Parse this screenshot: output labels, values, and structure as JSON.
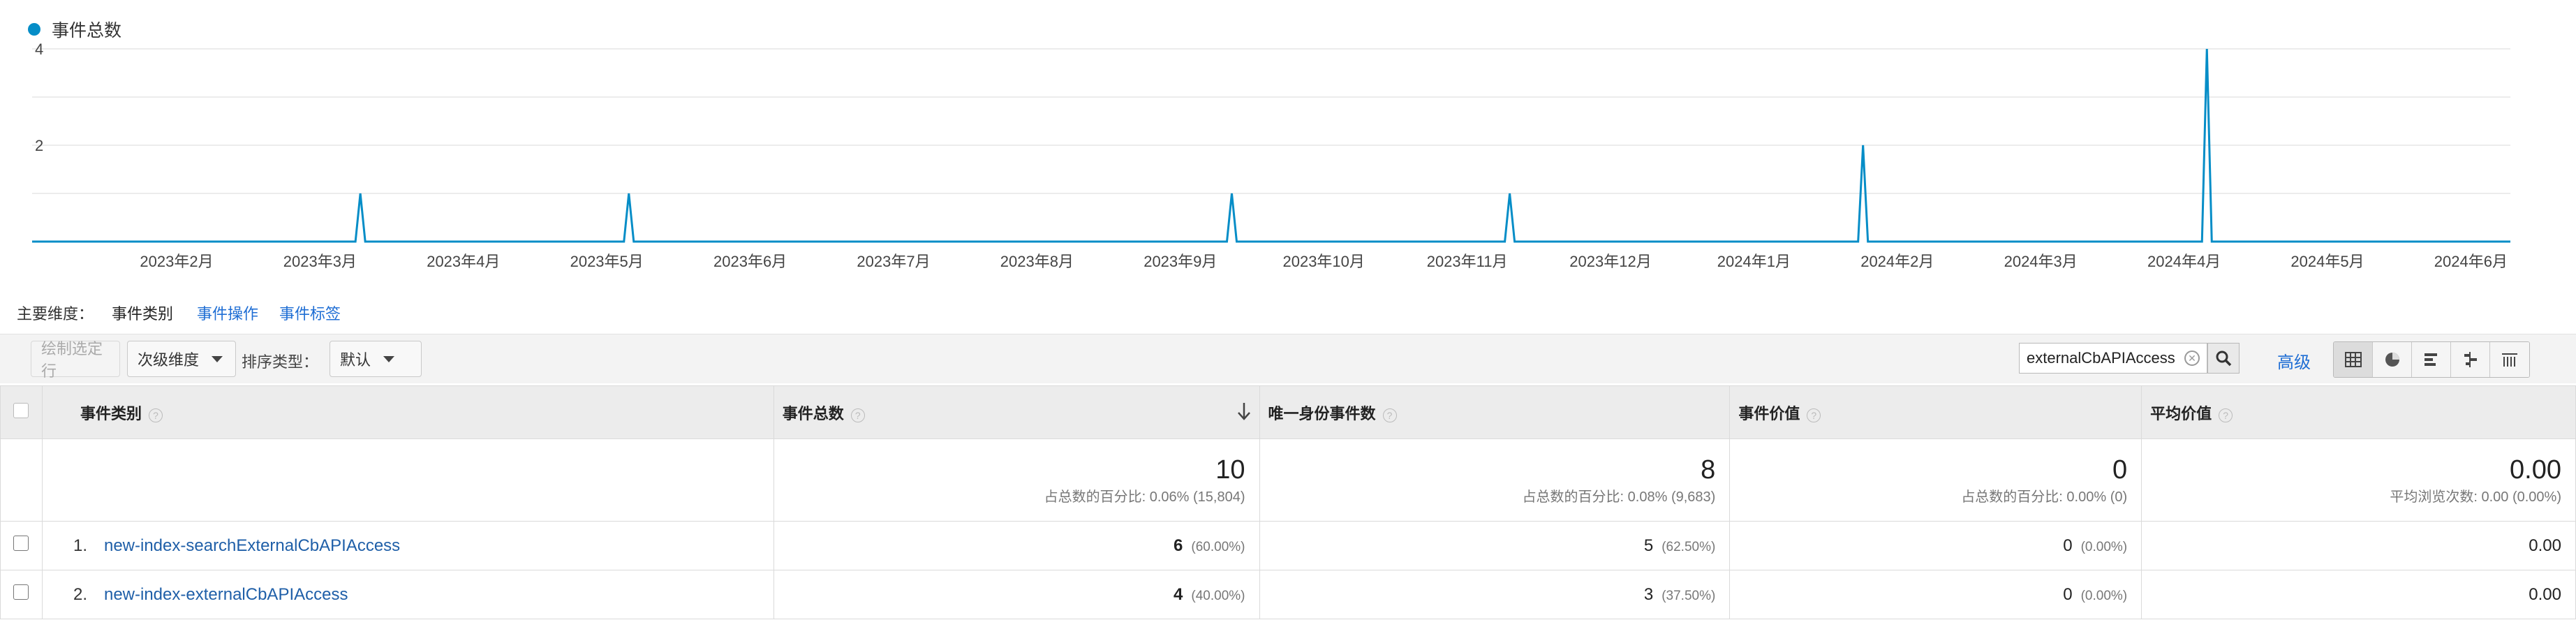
{
  "legend": {
    "label": "事件总数",
    "color": "#058dc7"
  },
  "chart_data": {
    "type": "line",
    "series": [
      {
        "name": "事件总数",
        "color": "#058dc7"
      }
    ],
    "y_ticks": [
      "4",
      "2"
    ],
    "ylim": [
      0,
      4
    ],
    "x_labels": [
      "2023年2月",
      "2023年3月",
      "2023年4月",
      "2023年5月",
      "2023年6月",
      "2023年7月",
      "2023年8月",
      "2023年9月",
      "2023年10月",
      "2023年11月",
      "2023年12月",
      "2024年1月",
      "2024年2月",
      "2024年3月",
      "2024年4月",
      "2024年5月",
      "2024年6月"
    ],
    "spikes": [
      {
        "date": "2023-03-12",
        "value": 1
      },
      {
        "date": "2023-05-08",
        "value": 1
      },
      {
        "date": "2023-09-13",
        "value": 1
      },
      {
        "date": "2023-11-11",
        "value": 1
      },
      {
        "date": "2024-01-25",
        "value": 2
      },
      {
        "date": "2024-04-07",
        "value": 4
      }
    ],
    "baseline": 0,
    "grid": true
  },
  "dimensions": {
    "label": "主要维度：",
    "current": "事件类别",
    "links": [
      "事件操作",
      "事件标签"
    ]
  },
  "toolbar": {
    "plot_rows": "绘制选定行",
    "secondary_dim": "次级维度",
    "sort_label": "排序类型：",
    "sort_value": "默认",
    "search_value": "externalCbAPIAccess",
    "advanced": "高级"
  },
  "table": {
    "headers": [
      "事件类别",
      "事件总数",
      "唯一身份事件数",
      "事件价值",
      "平均价值"
    ],
    "totals": [
      {
        "value": "10",
        "sub": "占总数的百分比: 0.06% (15,804)"
      },
      {
        "value": "8",
        "sub": "占总数的百分比: 0.08% (9,683)"
      },
      {
        "value": "0",
        "sub": "占总数的百分比: 0.00% (0)"
      },
      {
        "value": "0.00",
        "sub": "平均浏览次数: 0.00 (0.00%)"
      }
    ],
    "rows": [
      {
        "rank": "1.",
        "name": "new-index-searchExternalCbAPIAccess",
        "total": "6",
        "total_pct": "(60.00%)",
        "unique": "5",
        "unique_pct": "(62.50%)",
        "value": "0",
        "value_pct": "(0.00%)",
        "avg": "0.00"
      },
      {
        "rank": "2.",
        "name": "new-index-externalCbAPIAccess",
        "total": "4",
        "total_pct": "(40.00%)",
        "unique": "3",
        "unique_pct": "(37.50%)",
        "value": "0",
        "value_pct": "(0.00%)",
        "avg": "0.00"
      }
    ]
  }
}
